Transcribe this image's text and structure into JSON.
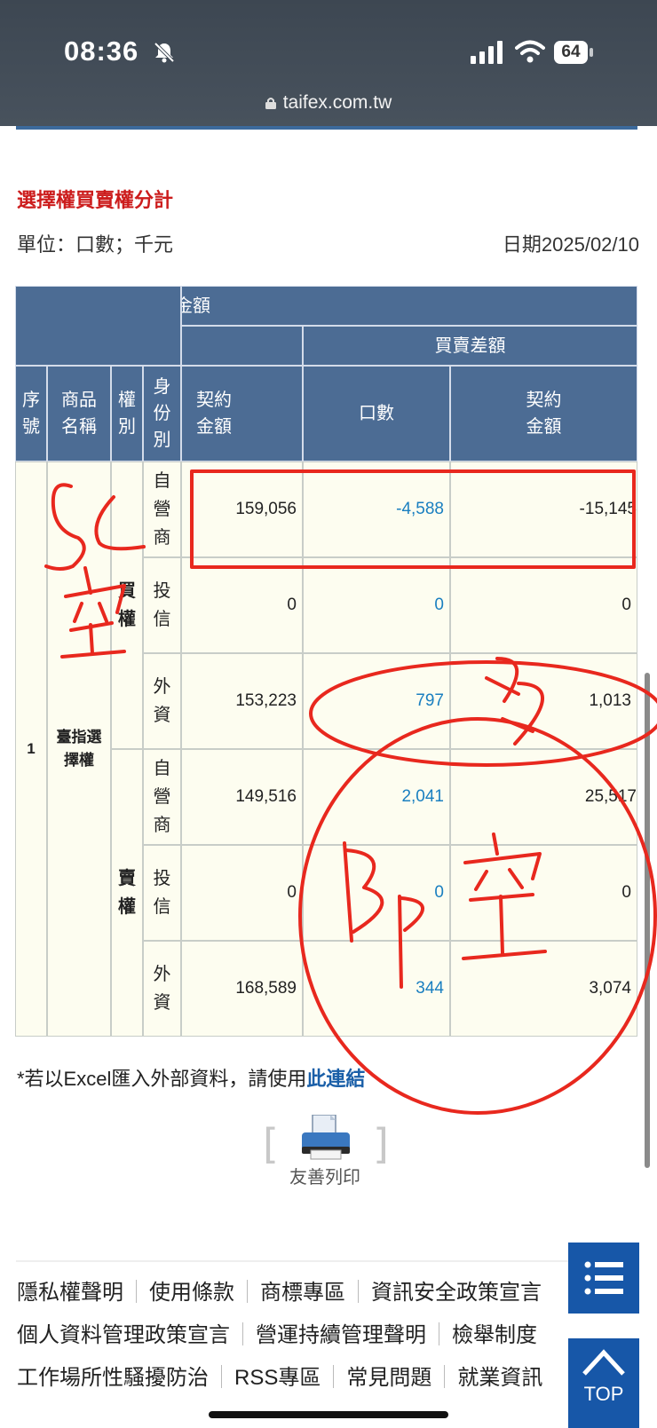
{
  "status_bar": {
    "time": "08:36",
    "battery": "64",
    "url": "taifex.com.tw"
  },
  "page": {
    "title": "選擇權買賣權分計",
    "unit": "單位：口數；千元",
    "date": "日期2025/02/10"
  },
  "table": {
    "header_amount": "金額",
    "header_net": "買賣差額",
    "col_seq": "序\n號",
    "col_product": "商品\n名稱",
    "col_right": "權\n別",
    "col_identity": "身\n份\n別",
    "col_contract_amount": "契約\n金額",
    "col_lots": "口數",
    "col_net_amount": "契約\n金額",
    "seq": "1",
    "product": "臺指選\n擇權",
    "right_buy": "買\n權",
    "right_sell": "賣\n權",
    "rows": [
      {
        "identity": "自\n營\n商",
        "amount": "159,056",
        "lots": "-4,588",
        "net": "-15,145"
      },
      {
        "identity": "投\n信",
        "amount": "0",
        "lots": "0",
        "net": "0"
      },
      {
        "identity": "外\n資",
        "amount": "153,223",
        "lots": "797",
        "net": "1,013"
      },
      {
        "identity": "自\n營\n商",
        "amount": "149,516",
        "lots": "2,041",
        "net": "25,517"
      },
      {
        "identity": "投\n信",
        "amount": "0",
        "lots": "0",
        "net": "0"
      },
      {
        "identity": "外\n資",
        "amount": "168,589",
        "lots": "344",
        "net": "3,074"
      }
    ]
  },
  "note": {
    "text": "*若以Excel匯入外部資料，請使用",
    "link": "此連結"
  },
  "print_label": "友善列印",
  "footer": {
    "row1": [
      "隱私權聲明",
      "使用條款",
      "商標專區",
      "資訊安全政策宣言"
    ],
    "row2": [
      "個人資料管理政策宣言",
      "營運持續管理聲明",
      "檢舉制度"
    ],
    "row3": [
      "工作場所性騷擾防治",
      "RSS專區",
      "常見問題",
      "就業資訊"
    ]
  },
  "top_button": "TOP",
  "annotation_color": "#e8281e"
}
